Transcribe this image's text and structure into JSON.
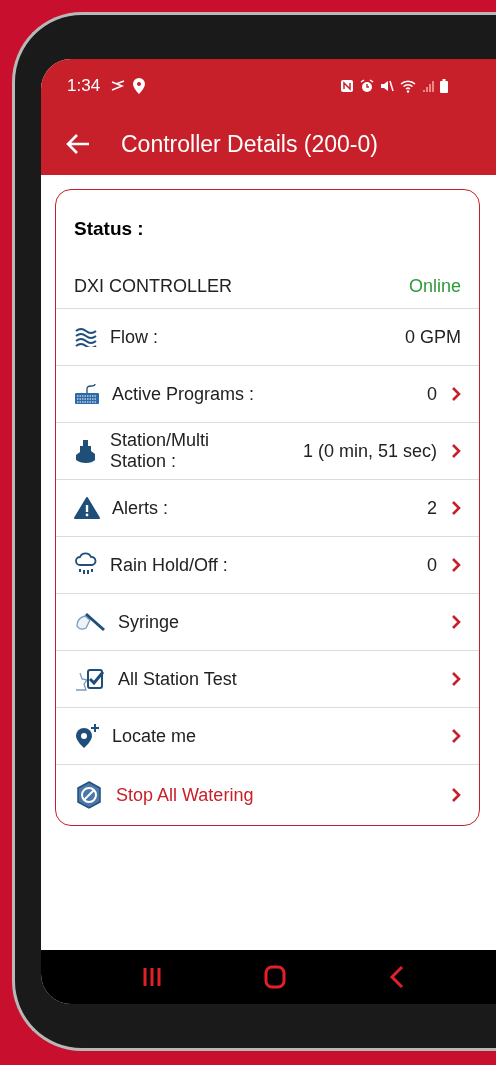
{
  "status_bar": {
    "time": "1:34"
  },
  "app_bar": {
    "title": "Controller Details (200-0)"
  },
  "card": {
    "heading": "Status :",
    "controller": "DXI CONTROLLER",
    "state": "Online",
    "rows": [
      {
        "kind": "flow",
        "label": "Flow :",
        "value": "0 GPM",
        "chevron": false,
        "warning": false
      },
      {
        "kind": "programs",
        "label": "Active Programs :",
        "value": "0",
        "chevron": true,
        "warning": false
      },
      {
        "kind": "station",
        "label": "Station/Multi Station :",
        "value": "1 (0 min, 51 sec)",
        "chevron": true,
        "warning": false
      },
      {
        "kind": "alert",
        "label": "Alerts :",
        "value": "2",
        "chevron": true,
        "warning": false
      },
      {
        "kind": "rain",
        "label": "Rain Hold/Off :",
        "value": "0",
        "chevron": true,
        "warning": false
      },
      {
        "kind": "syringe",
        "label": "Syringe",
        "chevron": true,
        "warning": false
      },
      {
        "kind": "test",
        "label": "All Station Test",
        "chevron": true,
        "warning": false
      },
      {
        "kind": "locate",
        "label": "Locate me",
        "chevron": true,
        "warning": false
      },
      {
        "kind": "stop",
        "label": "Stop All Watering",
        "chevron": true,
        "warning": true
      }
    ]
  }
}
